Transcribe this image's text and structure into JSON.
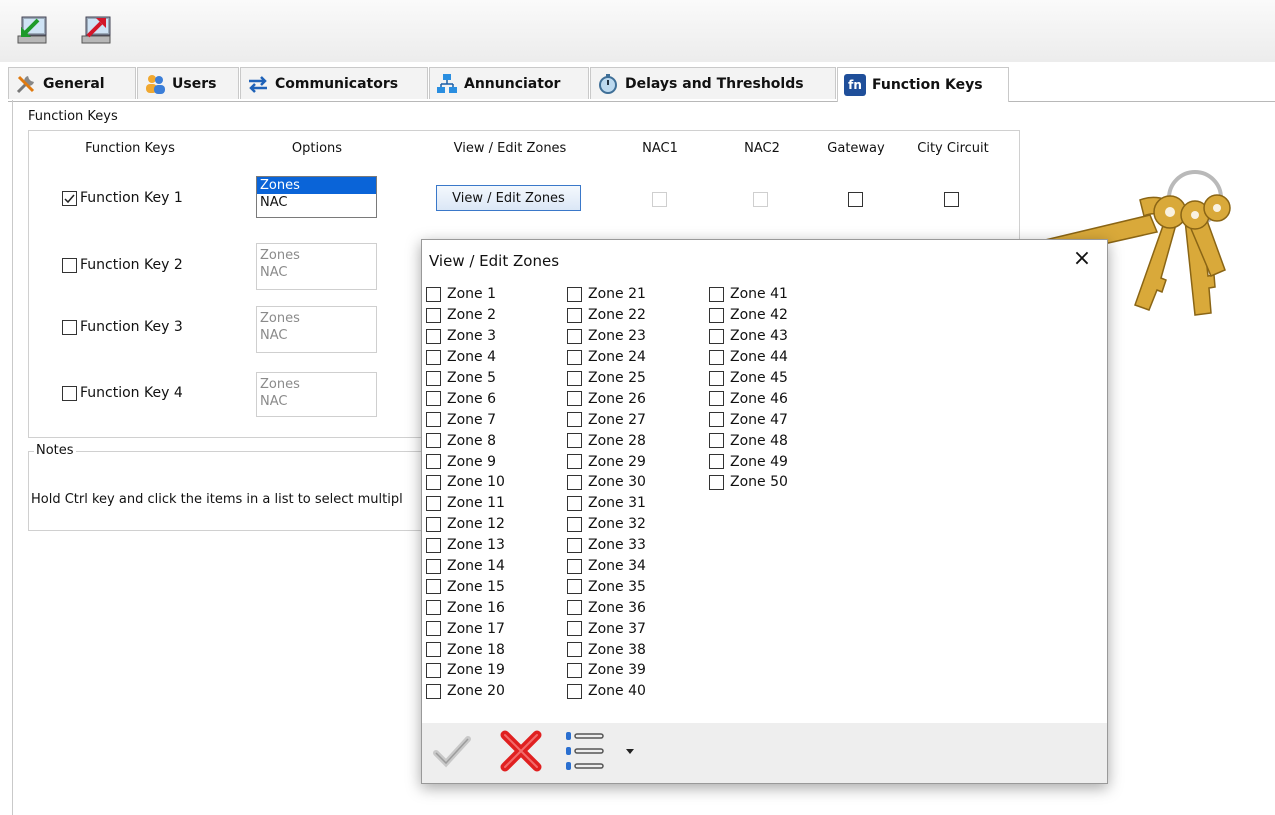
{
  "toolbar": {
    "buttons": [
      {
        "icon": "download-to-panel-icon"
      },
      {
        "icon": "upload-from-panel-icon"
      }
    ]
  },
  "tabs": [
    {
      "label": "General",
      "icon": "tools-icon"
    },
    {
      "label": "Users",
      "icon": "users-icon"
    },
    {
      "label": "Communicators",
      "icon": "arrows-exchange-icon"
    },
    {
      "label": "Annunciator",
      "icon": "network-icon"
    },
    {
      "label": "Delays and Thresholds",
      "icon": "timer-icon"
    },
    {
      "label": "Function Keys",
      "icon": "fn-icon",
      "icon_text": "fn",
      "active": true
    }
  ],
  "function_keys_group": {
    "title": "Function Keys",
    "headers": {
      "function_keys": "Function Keys",
      "options": "Options",
      "view_edit": "View / Edit Zones",
      "nac1": "NAC1",
      "nac2": "NAC2",
      "gateway": "Gateway",
      "city_circuit": "City Circuit"
    },
    "view_edit_button": "View / Edit Zones",
    "rows": [
      {
        "label": "Function Key 1",
        "checked": true,
        "options": [
          "Zones",
          "NAC"
        ],
        "selected": "Zones"
      },
      {
        "label": "Function Key 2",
        "checked": false,
        "options": [
          "Zones",
          "NAC"
        ]
      },
      {
        "label": "Function Key 3",
        "checked": false,
        "options": [
          "Zones",
          "NAC"
        ]
      },
      {
        "label": "Function Key 4",
        "checked": false,
        "options": [
          "Zones",
          "NAC"
        ]
      }
    ]
  },
  "notes_group": {
    "title": "Notes",
    "text": "Hold Ctrl key and click the items in a list to select multipl"
  },
  "dialog": {
    "title": "View / Edit Zones",
    "close_glyph": "×",
    "zones": [
      "Zone 1",
      "Zone 2",
      "Zone 3",
      "Zone 4",
      "Zone 5",
      "Zone 6",
      "Zone 7",
      "Zone 8",
      "Zone 9",
      "Zone 10",
      "Zone 11",
      "Zone 12",
      "Zone 13",
      "Zone 14",
      "Zone 15",
      "Zone 16",
      "Zone 17",
      "Zone 18",
      "Zone 19",
      "Zone 20",
      "Zone 21",
      "Zone 22",
      "Zone 23",
      "Zone 24",
      "Zone 25",
      "Zone 26",
      "Zone 27",
      "Zone 28",
      "Zone 29",
      "Zone 30",
      "Zone 31",
      "Zone 32",
      "Zone 33",
      "Zone 34",
      "Zone 35",
      "Zone 36",
      "Zone 37",
      "Zone 38",
      "Zone 39",
      "Zone 40",
      "Zone 41",
      "Zone 42",
      "Zone 43",
      "Zone 44",
      "Zone 45",
      "Zone 46",
      "Zone 47",
      "Zone 48",
      "Zone 49",
      "Zone 50"
    ],
    "buttons": [
      {
        "icon": "checkmark-icon",
        "state": "disabled"
      },
      {
        "icon": "red-x-icon"
      },
      {
        "icon": "numbered-list-icon"
      },
      {
        "icon": "dropdown-arrow-icon"
      }
    ]
  },
  "decor": {
    "icon": "keys-image"
  },
  "colors": {
    "selection": "#0a64d8",
    "fn_badge": "#1f4f9a",
    "cancel_red": "#e02020"
  }
}
